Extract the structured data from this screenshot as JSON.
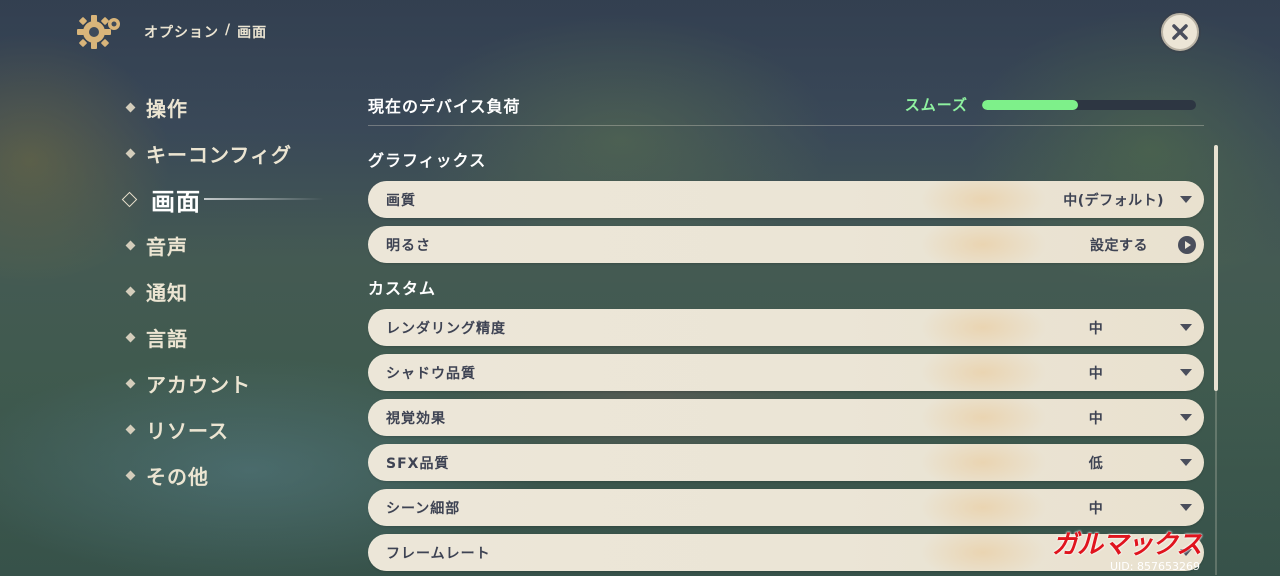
{
  "header": {
    "breadcrumb_parent": "オプション",
    "breadcrumb_sep": "/",
    "breadcrumb_current": "画面"
  },
  "nav": {
    "items": [
      {
        "label": "操作"
      },
      {
        "label": "キーコンフィグ"
      },
      {
        "label": "画面",
        "active": true
      },
      {
        "label": "音声"
      },
      {
        "label": "通知"
      },
      {
        "label": "言語"
      },
      {
        "label": "アカウント"
      },
      {
        "label": "リソース"
      },
      {
        "label": "その他"
      }
    ]
  },
  "device_load": {
    "label": "現在のデバイス負荷",
    "status": "スムーズ",
    "level_percent": 45,
    "color": "#7ef08a"
  },
  "graphics": {
    "title": "グラフィックス",
    "rows": [
      {
        "label": "画質",
        "value": "中(デフォルト)",
        "control": "dropdown"
      },
      {
        "label": "明るさ",
        "value": "設定する",
        "control": "action"
      }
    ]
  },
  "custom": {
    "title": "カスタム",
    "rows": [
      {
        "label": "レンダリング精度",
        "value": "中",
        "control": "dropdown"
      },
      {
        "label": "シャドウ品質",
        "value": "中",
        "control": "dropdown"
      },
      {
        "label": "視覚効果",
        "value": "中",
        "control": "dropdown"
      },
      {
        "label": "SFX品質",
        "value": "低",
        "control": "dropdown"
      },
      {
        "label": "シーン細部",
        "value": "中",
        "control": "dropdown"
      },
      {
        "label": "フレームレート",
        "value": "",
        "control": "dropdown"
      }
    ]
  },
  "watermark": "ガルマックス",
  "uid": "UID: 857653269",
  "icons": {
    "settings": "gear-icon",
    "close": "close-icon",
    "dropdown": "caret-down-icon",
    "action": "play-circle-icon"
  }
}
